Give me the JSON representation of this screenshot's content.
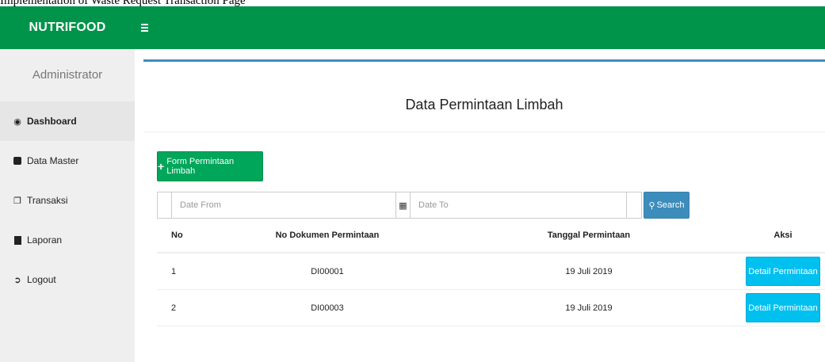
{
  "caption": "Implementation of Waste Request Transaction Page",
  "header": {
    "brand": "NUTRIFOOD",
    "menu_toggle_icon": "hamburger-icon",
    "brand_color": "#00944a"
  },
  "sidebar": {
    "user_label": "Administrator",
    "items": [
      {
        "label": "Dashboard",
        "icon": "dashboard-icon",
        "active": true
      },
      {
        "label": "Data Master",
        "icon": "archive-icon"
      },
      {
        "label": "Transaksi",
        "icon": "copy-icon"
      },
      {
        "label": "Laporan",
        "icon": "file-icon"
      },
      {
        "label": "Logout",
        "icon": "sign-out-icon"
      }
    ]
  },
  "main": {
    "title": "Data Permintaan Limbah",
    "form_button": "Form Permintaan Limbah",
    "filters": {
      "date_from_placeholder": "Date From",
      "date_to_placeholder": "Date To",
      "search_button": "Search"
    },
    "table": {
      "headers": [
        "No",
        "No Dokumen Permintaan",
        "Tanggal Permintaan",
        "Aksi"
      ],
      "rows": [
        {
          "no": "1",
          "doc": "DI00001",
          "date": "19 Juli 2019",
          "action": "Detail Permintaan"
        },
        {
          "no": "2",
          "doc": "DI00003",
          "date": "19 Juli 2019",
          "action": "Detail Permintaan"
        }
      ]
    }
  }
}
